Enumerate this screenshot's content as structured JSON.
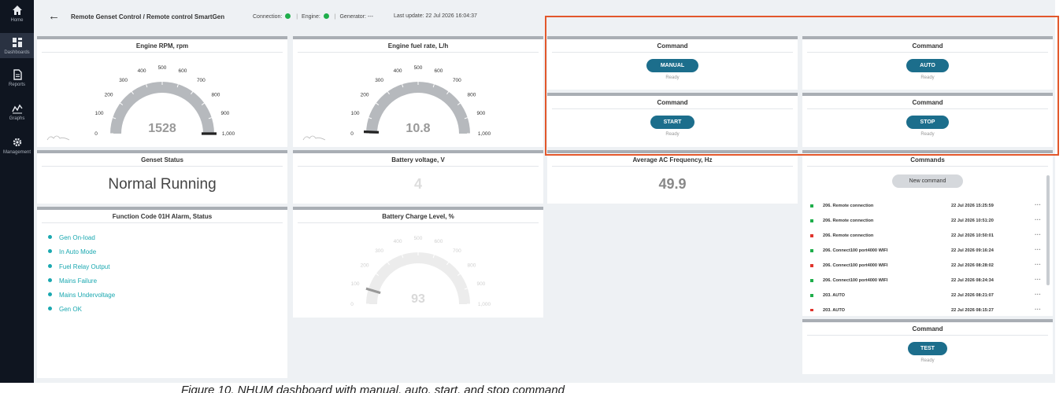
{
  "sidebar": {
    "items": [
      {
        "label": "Home",
        "icon": "home-icon"
      },
      {
        "label": "Dashboards",
        "icon": "dashboards-icon"
      },
      {
        "label": "Reports",
        "icon": "reports-icon"
      },
      {
        "label": "Graphs",
        "icon": "graphs-icon"
      },
      {
        "label": "Management",
        "icon": "gear-icon"
      }
    ]
  },
  "header": {
    "back_icon": "arrow-left-icon",
    "breadcrumb": "Remote Genset Control / Remote control SmartGen",
    "connection_label": "Connection:",
    "engine_label": "Engine:",
    "generator_label": "Generator:",
    "generator_value": "---",
    "last_update": "Last update: 22 Jul 2026 16:04:37",
    "status_color": "#1fae4b"
  },
  "widgets": {
    "rpm": {
      "title": "Engine RPM, rpm",
      "value": "1528",
      "value_num": 1528,
      "min": 0,
      "max": 1000,
      "ticks": [
        "0",
        "100",
        "200",
        "300",
        "400",
        "500",
        "600",
        "700",
        "800",
        "900",
        "1,000"
      ]
    },
    "fuel": {
      "title": "Engine fuel rate, L/h",
      "value": "10.8",
      "value_num": 10.8,
      "min": 0,
      "max": 1000,
      "ticks": [
        "0",
        "100",
        "200",
        "300",
        "400",
        "500",
        "600",
        "700",
        "800",
        "900",
        "1,000"
      ]
    },
    "genset_status": {
      "title": "Genset Status",
      "value": "Normal Running"
    },
    "battery_voltage": {
      "title": "Battery voltage, V",
      "value": "4"
    },
    "avg_freq": {
      "title": "Average AC Frequency, Hz",
      "value": "49.9"
    },
    "battery_charge": {
      "title": "Battery Charge Level, %",
      "value": "93",
      "value_num": 93,
      "min": 0,
      "max": 1000,
      "ticks": [
        "0",
        "100",
        "200",
        "300",
        "400",
        "500",
        "600",
        "700",
        "800",
        "900",
        "1,000"
      ]
    },
    "cmd_manual": {
      "title": "Command",
      "button": "MANUAL",
      "status": "Ready"
    },
    "cmd_auto": {
      "title": "Command",
      "button": "AUTO",
      "status": "Ready"
    },
    "cmd_start": {
      "title": "Command",
      "button": "START",
      "status": "Ready"
    },
    "cmd_stop": {
      "title": "Command",
      "button": "STOP",
      "status": "Ready"
    },
    "cmd_test": {
      "title": "Command",
      "button": "TEST",
      "status": "Ready"
    },
    "alarms": {
      "title": "Function Code 01H Alarm, Status",
      "items": [
        "Gen On-load",
        "In Auto Mode",
        "Fuel Relay Output",
        "Mains Failure",
        "Mains Undervoltage",
        "Gen OK"
      ],
      "color": "#1aa8b0"
    },
    "commands": {
      "title": "Commands",
      "new_button": "New command",
      "more_glyph": "···",
      "rows": [
        {
          "name": "206. Remote connection",
          "date": "22 Jul 2026 15:25:59",
          "color": "#1fae4b"
        },
        {
          "name": "206. Remote connection",
          "date": "22 Jul 2026 10:51:20",
          "color": "#1fae4b"
        },
        {
          "name": "206. Remote connection",
          "date": "22 Jul 2026 10:50:01",
          "color": "#e0342c"
        },
        {
          "name": "206. Connect100 port4000 WIFI",
          "date": "22 Jul 2026 09:16:24",
          "color": "#1fae4b"
        },
        {
          "name": "206. Connect100 port4000 WIFI",
          "date": "22 Jul 2026 08:28:02",
          "color": "#e0342c"
        },
        {
          "name": "206. Connect100 port4000 WIFI",
          "date": "22 Jul 2026 08:24:34",
          "color": "#1fae4b"
        },
        {
          "name": "203. AUTO",
          "date": "22 Jul 2026 08:21:07",
          "color": "#1fae4b"
        },
        {
          "name": "203. AUTO",
          "date": "22 Jul 2026 08:15:27",
          "color": "#e0342c"
        }
      ]
    }
  },
  "colors": {
    "accent": "#1c6e8c",
    "highlight": "#e2572b"
  },
  "caption": "Figure 10. NHUM dashboard with manual, auto, start, and stop command"
}
